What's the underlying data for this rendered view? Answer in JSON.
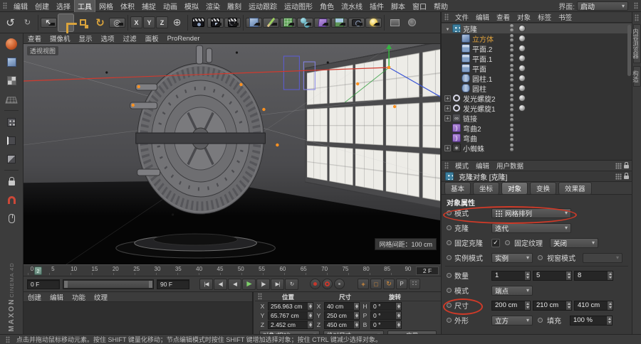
{
  "app": {
    "brand_line1": "MAXON",
    "brand_line2": "CINEMA 4D"
  },
  "menubar": {
    "items": [
      {
        "label": "编辑"
      },
      {
        "label": "创建"
      },
      {
        "label": "选择"
      },
      {
        "label": "工具",
        "active": true
      },
      {
        "label": "网格"
      },
      {
        "label": "体积"
      },
      {
        "label": "捕捉"
      },
      {
        "label": "动画"
      },
      {
        "label": "模拟"
      },
      {
        "label": "渲染"
      },
      {
        "label": "雕刻"
      },
      {
        "label": "运动跟踪"
      },
      {
        "label": "运动图形"
      },
      {
        "label": "角色"
      },
      {
        "label": "流水线"
      },
      {
        "label": "插件"
      },
      {
        "label": "脚本"
      },
      {
        "label": "窗口"
      },
      {
        "label": "帮助"
      }
    ],
    "interface_label": "界面:",
    "interface_value": "启动"
  },
  "toolbar": {
    "icons": [
      "undo",
      "redo",
      "select",
      "move",
      "scale",
      "rotate",
      "last-tool",
      "axis-x",
      "axis-y",
      "axis-z",
      "coordinate-system",
      "render-view",
      "render-picture-viewer",
      "edit-render-settings",
      "add-cube",
      "pen-spline",
      "subdivision-surface",
      "mograph-cloner",
      "deformer",
      "environment",
      "camera",
      "light",
      "display-filter",
      "viewport-solo"
    ],
    "axis_x": "X",
    "axis_y": "Y",
    "axis_z": "Z"
  },
  "leftbar": {
    "icons": [
      "make-editable",
      "model-mode",
      "texture-mode",
      "workplane-mode",
      "points-mode",
      "edges-mode",
      "polygons-mode",
      "lock",
      "snapping",
      "mouse-move"
    ]
  },
  "viewport": {
    "menu": [
      "查看",
      "摄像机",
      "显示",
      "选项",
      "过滤",
      "面板",
      "ProRender"
    ],
    "view_label": "透视视图",
    "grid_label": "网格间距：100 cm"
  },
  "timeline": {
    "ticks": [
      "0",
      "5",
      "10",
      "15",
      "20",
      "25",
      "30",
      "35",
      "40",
      "45",
      "50",
      "55",
      "60",
      "65",
      "70",
      "75",
      "80",
      "85",
      "90"
    ],
    "marker_label": "2",
    "current_frame": "2 F"
  },
  "transport": {
    "start_field": "0 F",
    "end_field": "90 F",
    "buttons": [
      {
        "label": "|◀",
        "name": "goto-start-button"
      },
      {
        "label": "◀|",
        "name": "prev-key-button"
      },
      {
        "label": "◀",
        "name": "prev-frame-button"
      },
      {
        "label": "▶",
        "name": "play-button",
        "cls": "play"
      },
      {
        "label": "|▶",
        "name": "next-key-button"
      },
      {
        "label": "▶|",
        "name": "goto-end-button"
      },
      {
        "label": "↻",
        "name": "loop-button"
      }
    ]
  },
  "materials": {
    "menu": [
      "创建",
      "编辑",
      "功能",
      "纹理"
    ]
  },
  "coordinates": {
    "sections": [
      "位置",
      "尺寸",
      "旋转"
    ],
    "rows": [
      {
        "a": "X",
        "pos": "256.963 cm",
        "b": "X",
        "size": "40 cm",
        "c": "H",
        "rot": "0 °"
      },
      {
        "a": "Y",
        "pos": "65.767 cm",
        "b": "Y",
        "size": "250 cm",
        "c": "P",
        "rot": "0 °"
      },
      {
        "a": "Z",
        "pos": "2.452 cm",
        "b": "Z",
        "size": "450 cm",
        "c": "B",
        "rot": "0 °"
      }
    ],
    "mode_dropdown": "对象(相对)",
    "size_dropdown": "绝对尺寸",
    "apply_button": "应用"
  },
  "object_manager": {
    "menu": [
      "文件",
      "编辑",
      "查看",
      "对象",
      "标签",
      "书签"
    ],
    "items": [
      {
        "label": "克隆",
        "icon": "cloner",
        "indent": 0,
        "expander": "open",
        "selected": true,
        "tag": true
      },
      {
        "label": "立方体",
        "icon": "cube",
        "indent": 1,
        "color": "#e0a23c",
        "tag": true
      },
      {
        "label": "平面.2",
        "icon": "plane",
        "indent": 1,
        "tag": true
      },
      {
        "label": "平面.1",
        "icon": "plane",
        "indent": 1,
        "tag": true
      },
      {
        "label": "平面",
        "icon": "plane",
        "indent": 1,
        "tag": true
      },
      {
        "label": "圆柱.1",
        "icon": "cylinder",
        "indent": 1,
        "tag": true
      },
      {
        "label": "圆柱",
        "icon": "cylinder",
        "indent": 1,
        "tag": true
      },
      {
        "label": "发光螺旋2",
        "icon": "spiral",
        "indent": 0,
        "expander": "plus",
        "tag": true
      },
      {
        "label": "发光螺旋1",
        "icon": "spiral",
        "indent": 0,
        "expander": "plus",
        "tag": true
      },
      {
        "label": "链接",
        "icon": "link",
        "indent": 0,
        "expander": "plus",
        "tag": false
      },
      {
        "label": "弯曲2",
        "icon": "bend",
        "indent": 0,
        "tag": false
      },
      {
        "label": "弯曲",
        "icon": "bend",
        "indent": 0,
        "tag": false
      },
      {
        "label": "小蜘蛛",
        "icon": "spider",
        "indent": 0,
        "expander": "plus",
        "tag": false
      }
    ]
  },
  "attributes": {
    "menu": [
      "模式",
      "编辑",
      "用户数据"
    ],
    "title": "克隆对象 [克隆]",
    "tabs": [
      {
        "label": "基本"
      },
      {
        "label": "坐标"
      },
      {
        "label": "对象",
        "active": true
      },
      {
        "label": "变换"
      },
      {
        "label": "效果器"
      }
    ],
    "section_title": "对象属性",
    "rows": [
      {
        "label": "模式",
        "value": "网格排列"
      },
      {
        "label": "克隆",
        "value": "迭代"
      },
      {
        "label": "固定克隆",
        "checked": true,
        "label2": "固定纹理",
        "value2": "关闭"
      },
      {
        "label": "实例模式",
        "value": "实例",
        "label2": "视窗模式",
        "value2": ""
      },
      {
        "label": "数量",
        "values": [
          "1",
          "5",
          "8"
        ]
      },
      {
        "label": "模式",
        "value": "端点"
      },
      {
        "label": "尺寸",
        "values": [
          "200 cm",
          "210 cm",
          "410 cm"
        ]
      },
      {
        "label": "外形",
        "value": "立方",
        "label2": "填充",
        "value2": "100 %"
      }
    ]
  },
  "right_strip": {
    "tabs": [
      "内容浏览器",
      "构造"
    ]
  },
  "statusbar": {
    "text": "点击并拖动鼠标移动元素。按住 SHIFT 键量化移动；节点编辑模式时按住 SHIFT 键增加选择对象；按住 CTRL 键减少选择对象。"
  },
  "annotations": {
    "color": "#cf3a28"
  }
}
